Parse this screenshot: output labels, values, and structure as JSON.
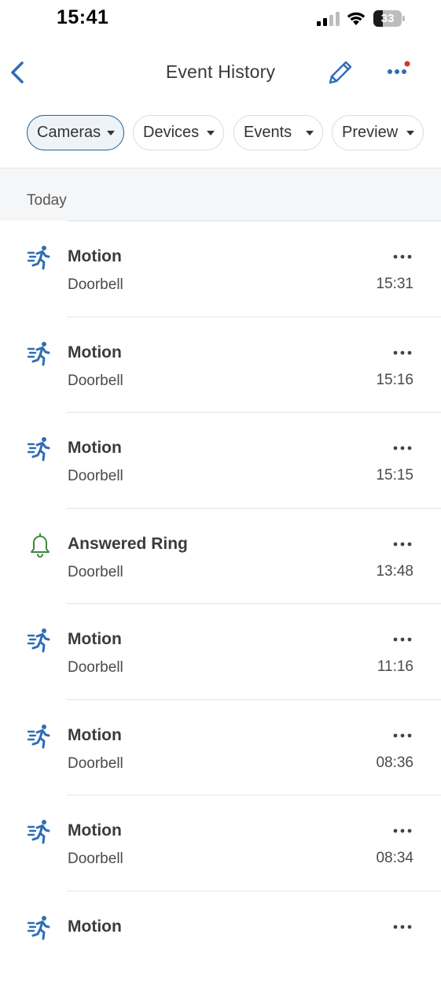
{
  "status_bar": {
    "time": "15:41",
    "battery_percent": 33,
    "battery_label": "33"
  },
  "nav": {
    "title": "Event History",
    "accent_color": "#2f6db5",
    "notification_dot_color": "#d9342b"
  },
  "filters": [
    {
      "label": "Cameras",
      "active": true
    },
    {
      "label": "Devices",
      "active": false
    },
    {
      "label": "Events",
      "active": false
    },
    {
      "label": "Preview",
      "active": false
    }
  ],
  "section": {
    "label": "Today"
  },
  "events": [
    {
      "type": "Motion",
      "icon": "running-person-icon",
      "device": "Doorbell",
      "time": "15:31"
    },
    {
      "type": "Motion",
      "icon": "running-person-icon",
      "device": "Doorbell",
      "time": "15:16"
    },
    {
      "type": "Motion",
      "icon": "running-person-icon",
      "device": "Doorbell",
      "time": "15:15"
    },
    {
      "type": "Answered Ring",
      "icon": "bell-icon",
      "device": "Doorbell",
      "time": "13:48"
    },
    {
      "type": "Motion",
      "icon": "running-person-icon",
      "device": "Doorbell",
      "time": "11:16"
    },
    {
      "type": "Motion",
      "icon": "running-person-icon",
      "device": "Doorbell",
      "time": "08:36"
    },
    {
      "type": "Motion",
      "icon": "running-person-icon",
      "device": "Doorbell",
      "time": "08:34"
    },
    {
      "type": "Motion",
      "icon": "running-person-icon",
      "device": "",
      "time": ""
    }
  ],
  "colors": {
    "motion_icon": "#2f6db5",
    "ring_icon": "#3c8a3c"
  }
}
